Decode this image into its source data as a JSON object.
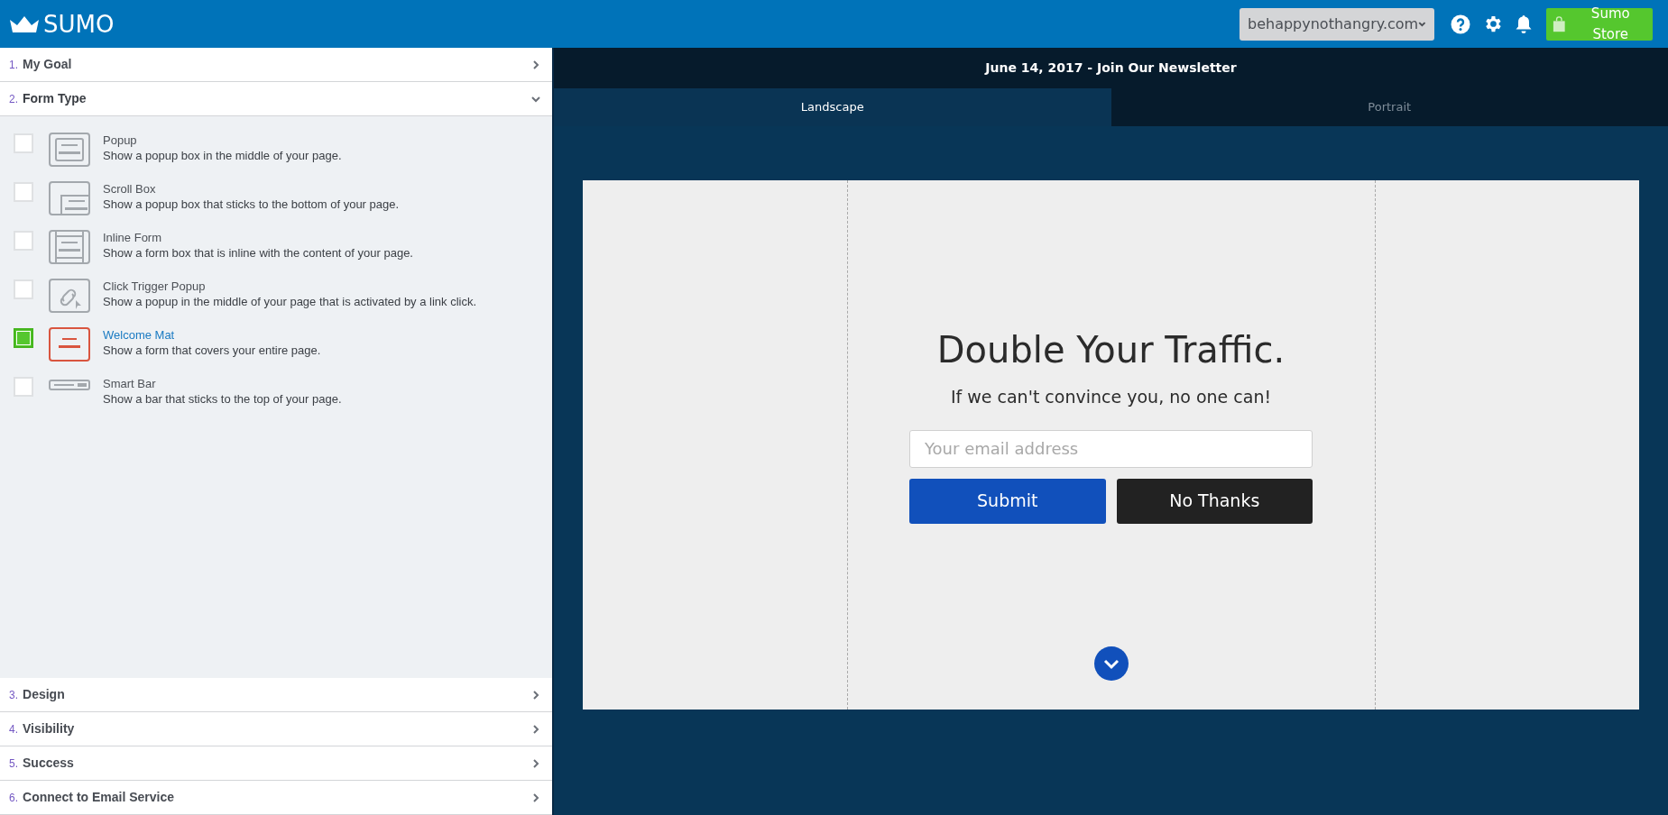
{
  "header": {
    "logo": "SUMO",
    "site_select": {
      "value": "behappynothangry.com"
    },
    "store_button": "Sumo Store"
  },
  "steps": [
    {
      "number": "1.",
      "title": "My Goal",
      "expanded": false
    },
    {
      "number": "2.",
      "title": "Form Type",
      "expanded": true,
      "options": [
        {
          "kind": "popup",
          "title": "Popup",
          "description": "Show a popup box in the middle of your page.",
          "selected": false
        },
        {
          "kind": "scroll_box",
          "title": "Scroll Box",
          "description": "Show a popup box that sticks to the bottom of your page.",
          "selected": false
        },
        {
          "kind": "inline",
          "title": "Inline Form",
          "description": "Show a form box that is inline with the content of your page.",
          "selected": false
        },
        {
          "kind": "click_trigger",
          "title": "Click Trigger Popup",
          "description": "Show a popup in the middle of your page that is activated by a link click.",
          "selected": false
        },
        {
          "kind": "welcome_mat",
          "title": "Welcome Mat",
          "description": "Show a form that covers your entire page.",
          "selected": true
        },
        {
          "kind": "smart_bar",
          "title": "Smart Bar",
          "description": "Show a bar that sticks to the top of your page.",
          "selected": false
        }
      ]
    },
    {
      "number": "3.",
      "title": "Design",
      "expanded": false
    },
    {
      "number": "4.",
      "title": "Visibility",
      "expanded": false
    },
    {
      "number": "5.",
      "title": "Success",
      "expanded": false
    },
    {
      "number": "6.",
      "title": "Connect to Email Service",
      "expanded": false
    }
  ],
  "preview": {
    "title": "June 14, 2017 - Join Our Newsletter",
    "tabs": [
      {
        "label": "Landscape",
        "selected": true
      },
      {
        "label": "Portrait",
        "selected": false
      }
    ],
    "heading": "Double Your Traffic.",
    "subheading": "If we can't convince you, no one can!",
    "email_field": {
      "placeholder": "Your email address"
    },
    "submit_button": "Submit",
    "dismiss_button": "No Thanks"
  }
}
